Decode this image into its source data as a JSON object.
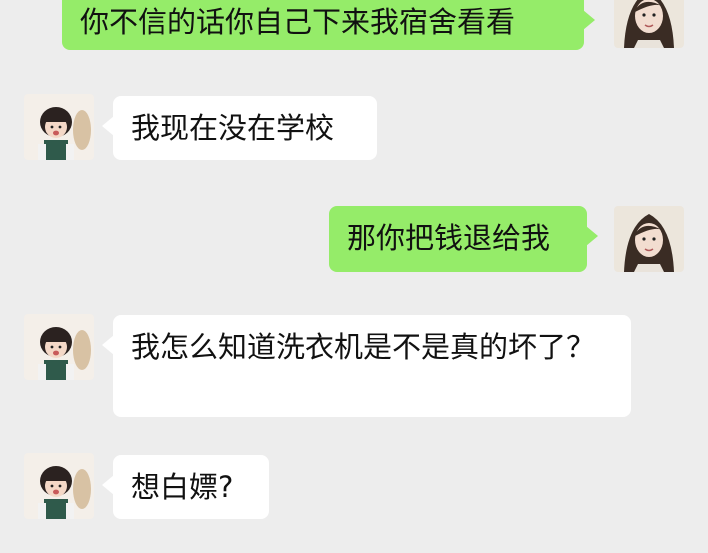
{
  "messages": [
    {
      "side": "out",
      "text": "你不信的话你自己下来我宿舍看看",
      "avatar": "woman-avatar"
    },
    {
      "side": "in",
      "text": "我现在没在学校",
      "avatar": "girl-avatar"
    },
    {
      "side": "out",
      "text": "那你把钱退给我",
      "avatar": "woman-avatar"
    },
    {
      "side": "in",
      "text": "我怎么知道洗衣机是不是真的坏了？",
      "avatar": "girl-avatar"
    },
    {
      "side": "in",
      "text": "想白嫖?",
      "avatar": "girl-avatar"
    }
  ],
  "colors": {
    "background": "#ededed",
    "incoming_bubble": "#ffffff",
    "outgoing_bubble": "#95ec69"
  }
}
